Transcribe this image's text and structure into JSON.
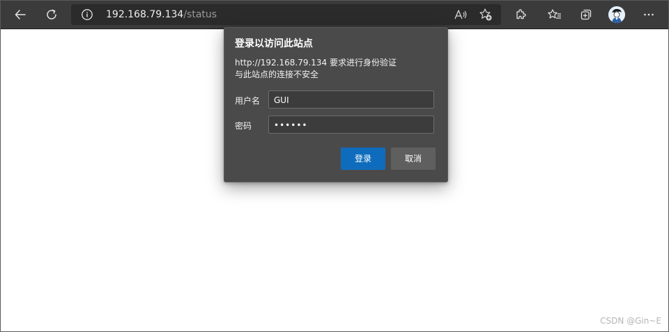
{
  "browser": {
    "address": {
      "host": "192.168.79.134",
      "path": "/status"
    },
    "icons": {
      "back": "back-arrow-icon",
      "refresh": "refresh-icon",
      "info": "info-icon",
      "read_aloud": "read-aloud-icon",
      "add_favorite": "add-favorite-icon",
      "extensions": "extensions-icon",
      "favorites": "favorites-icon",
      "collections": "collections-icon",
      "profile": "profile-avatar",
      "more": "more-icon"
    }
  },
  "dialog": {
    "title": "登录以访问此站点",
    "message_line1": "http://192.168.79.134 要求进行身份验证",
    "message_line2": "与此站点的连接不安全",
    "username_label": "用户名",
    "username_value": "GUI",
    "password_label": "密码",
    "password_value": "••••••",
    "login_button": "登录",
    "cancel_button": "取消"
  },
  "watermark": "CSDN @Gin~E",
  "colors": {
    "toolbar_bg": "#3b3b3b",
    "dialog_bg": "#4a4a4a",
    "primary_button": "#0f6cbd",
    "secondary_button": "#5f5f5f"
  }
}
